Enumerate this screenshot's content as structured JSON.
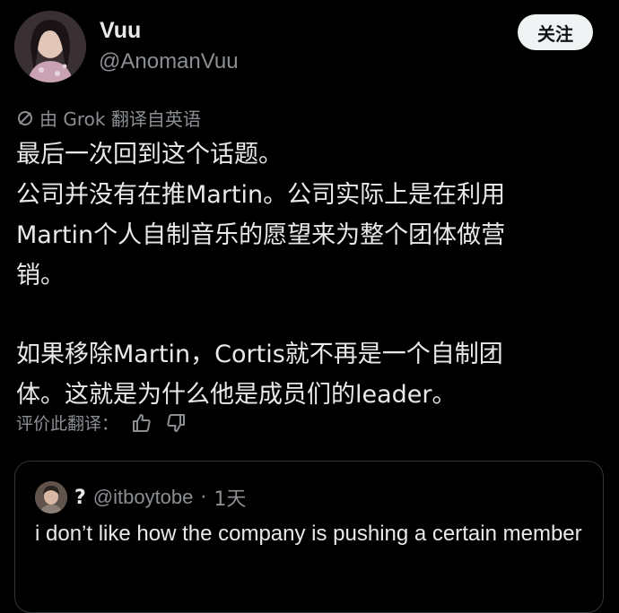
{
  "author": {
    "display_name": "Vuu",
    "handle": "@AnomanVuu",
    "avatar_icon": "user-avatar"
  },
  "follow_button": {
    "label": "关注"
  },
  "translation": {
    "icon": "slash-circle-icon",
    "label": "由 Grok 翻译自英语"
  },
  "post": {
    "lines": [
      "最后一次回到这个话题。",
      "公司并没有在推Martin。公司实际上是在利用",
      "Martin个人自制音乐的愿望来为整个团体做营",
      "销。",
      "",
      "如果移除Martin，Cortis就不再是一个自制团",
      "体。这就是为什么他是成员们的leader。"
    ]
  },
  "rating": {
    "label": "评价此翻译：",
    "thumbs_up_icon": "thumbs-up-icon",
    "thumbs_down_icon": "thumbs-down-icon"
  },
  "quoted_post": {
    "name": "?",
    "handle": "@itboytobe",
    "separator": "·",
    "time": "1天",
    "text": "i don’t like how the company is pushing a certain member"
  },
  "colors": {
    "background": "#000000",
    "text_primary": "#e7e9ea",
    "text_secondary": "#8b8f94",
    "follow_bg": "#eff3f4",
    "card_border": "#33363a"
  }
}
